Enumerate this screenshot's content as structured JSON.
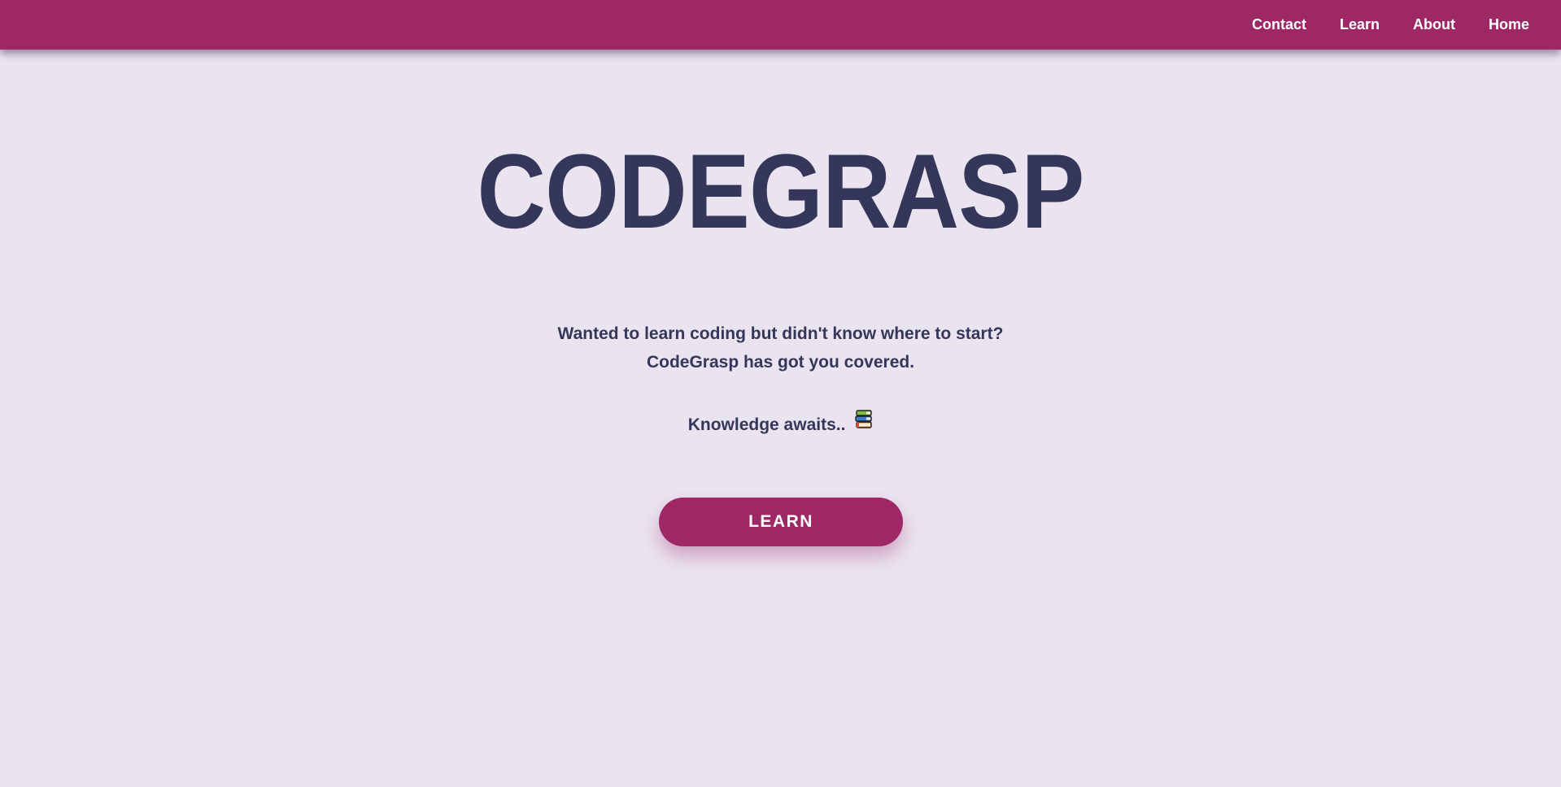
{
  "nav": {
    "links": [
      {
        "label": "Contact"
      },
      {
        "label": "Learn"
      },
      {
        "label": "About"
      },
      {
        "label": "Home"
      }
    ]
  },
  "hero": {
    "title": "CODEGRASP",
    "tagline_line1": "Wanted to learn coding but didn't know where to start?",
    "tagline_line2": "CodeGrasp has got you covered.",
    "knowledge_text": "Knowledge awaits..",
    "knowledge_icon": "books-icon",
    "button_label": "LEARN"
  },
  "colors": {
    "nav_background": "#9e2866",
    "page_background": "#eae3f0",
    "text": "#35375a",
    "button_background": "#9e2866",
    "button_text": "#ffffff"
  }
}
